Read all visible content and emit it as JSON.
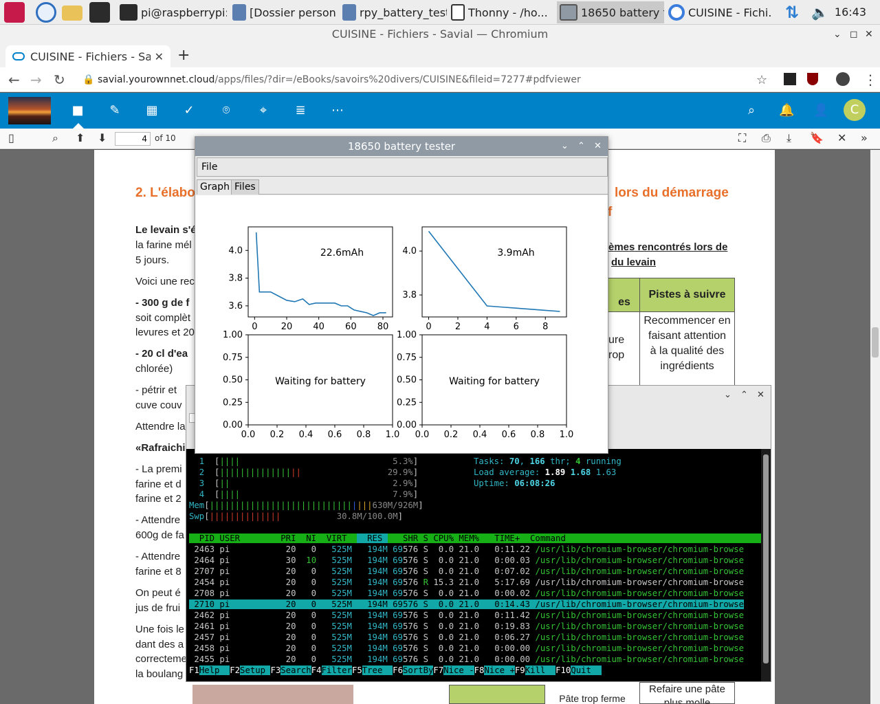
{
  "taskbar": {
    "buttons": [
      {
        "label": "pi@raspberrypi:..."
      },
      {
        "label": "[Dossier person..."
      },
      {
        "label": "rpy_battery_test..."
      },
      {
        "label": "Thonny  -  /ho..."
      },
      {
        "label": "18650 battery t..."
      },
      {
        "label": "CUISINE - Fichi..."
      }
    ],
    "clock": "16:43"
  },
  "browser": {
    "window_title": "CUISINE - Fichiers - Savial — Chromium",
    "tab_title": "CUISINE - Fichiers - Savia",
    "url_host": "savial.yourownnet.cloud",
    "url_path": "/apps/files/?dir=/eBooks/savoirs%20divers/CUISINE&fileid=7277#pdfviewer"
  },
  "nextcloud": {
    "avatar_letter": "C"
  },
  "pdfviewer": {
    "page_number": "4",
    "page_of": "of 10",
    "heading1": "2. L'élabo",
    "heading_right1": "lors du démarrage",
    "heading_right2": "f",
    "lines": [
      "Le levain s'é",
      "la farine mél",
      "5 jours.",
      "Voici une rec",
      "- 300 g de f",
      "soit complèt",
      "levures et 20",
      "- 20 cl d'ea",
      "chlorée)",
      "- pétrir et",
      "cuve couv",
      "Attendre la",
      "«Rafraichi",
      "- La premi",
      "farine et d",
      "farine et 2",
      "-  Attendre",
      "600g de fa",
      "- Attendre",
      "farine et 8",
      "On peut é",
      "jus de frui",
      "Une fois le",
      "dant des a",
      "correcteme",
      "la boulang"
    ],
    "side_head1": "èmes rencontrés lors de",
    "side_head2": "du levain",
    "table_header_left": "es",
    "table_header_right": "Pistes à suivre",
    "table_cell_left1": "ure",
    "table_cell_left2": "rop",
    "table_cell_right": [
      "Recommencer en",
      "faisant attention",
      "à la qualité des",
      "ingrédients"
    ],
    "bottom_cell_right": [
      "Refaire une pâte",
      "plus molle"
    ],
    "bottom_cell_mid": "Pâte trop ferme"
  },
  "battery_app": {
    "title": "18650 battery tester",
    "menu_file": "File",
    "tab_graph": "Graph",
    "tab_files": "Files"
  },
  "chart_data": [
    {
      "type": "line",
      "annotation": "22.6mAh",
      "x": [
        1,
        3,
        10,
        15,
        20,
        25,
        30,
        34,
        38,
        42,
        46,
        50,
        54,
        58,
        62,
        66,
        70,
        74,
        78,
        82
      ],
      "y": [
        4.13,
        3.7,
        3.7,
        3.67,
        3.64,
        3.63,
        3.65,
        3.61,
        3.62,
        3.62,
        3.62,
        3.62,
        3.6,
        3.6,
        3.57,
        3.56,
        3.55,
        3.53,
        3.55,
        3.55
      ],
      "xlim": [
        -4,
        86
      ],
      "ylim": [
        3.52,
        4.17
      ],
      "xticks": [
        "0",
        "20",
        "40",
        "60",
        "80"
      ],
      "yticks": [
        "4.0",
        "3.8",
        "3.6"
      ]
    },
    {
      "type": "line",
      "annotation": "3.9mAh",
      "x": [
        0,
        4,
        5,
        6,
        7,
        8,
        9
      ],
      "y": [
        4.09,
        3.75,
        3.745,
        3.74,
        3.735,
        3.73,
        3.725
      ],
      "xlim": [
        -0.45,
        9.45
      ],
      "ylim": [
        3.7,
        4.11
      ],
      "xticks": [
        "0",
        "2",
        "4",
        "6",
        "8"
      ],
      "yticks": [
        "4.0",
        "3.8"
      ]
    },
    {
      "type": "line",
      "annotation": "Waiting for battery",
      "x": [],
      "y": [],
      "xlim": [
        0,
        1
      ],
      "ylim": [
        0,
        1
      ],
      "xticks": [
        "0.0",
        "0.2",
        "0.4",
        "0.6",
        "0.8",
        "1.0"
      ],
      "yticks": [
        "1.00",
        "0.75",
        "0.50",
        "0.25",
        "0.00"
      ]
    },
    {
      "type": "line",
      "annotation": "Waiting for battery",
      "x": [],
      "y": [],
      "xlim": [
        0,
        1
      ],
      "ylim": [
        0,
        1
      ],
      "xticks": [
        "0.0",
        "0.2",
        "0.4",
        "0.6",
        "0.8",
        "1.0"
      ],
      "yticks": [
        "1.00",
        "0.75",
        "0.50",
        "0.25",
        "0.00"
      ]
    }
  ],
  "htop": {
    "cpus": [
      {
        "num": "1",
        "pct": "5.3%"
      },
      {
        "num": "2",
        "pct": "29.9%"
      },
      {
        "num": "3",
        "pct": "2.9%"
      },
      {
        "num": "4",
        "pct": "7.9%"
      }
    ],
    "mem": "630M/926M",
    "swp": "30.8M/100.0M",
    "tasks": "70",
    "threads": "166",
    "running": "4",
    "load1": "1.89",
    "load5": "1.68",
    "load15": "1.63",
    "uptime": "06:08:26",
    "columns": [
      "PID",
      "USER",
      "PRI",
      "NI",
      "VIRT",
      "RES",
      "SHR",
      "S",
      "CPU%",
      "MEM%",
      "TIME+",
      "Command"
    ],
    "rows": [
      {
        "pid": "2463",
        "user": "pi",
        "pri": "20",
        "ni": "0",
        "virt": "525M",
        "res": "194M",
        "shr": "69576",
        "s": "S",
        "cpu": "0.0",
        "mem": "21.0",
        "time": "0:11.22",
        "cmd": "/usr/lib/chromium-browser/chromium-browse"
      },
      {
        "pid": "2464",
        "user": "pi",
        "pri": "30",
        "ni": "10",
        "virt": "525M",
        "res": "194M",
        "shr": "69576",
        "s": "S",
        "cpu": "0.0",
        "mem": "21.0",
        "time": "0:00.03",
        "cmd": "/usr/lib/chromium-browser/chromium-browse"
      },
      {
        "pid": "2707",
        "user": "pi",
        "pri": "20",
        "ni": "0",
        "virt": "525M",
        "res": "194M",
        "shr": "69576",
        "s": "S",
        "cpu": "0.0",
        "mem": "21.0",
        "time": "0:07.02",
        "cmd": "/usr/lib/chromium-browser/chromium-browse"
      },
      {
        "pid": "2454",
        "user": "pi",
        "pri": "20",
        "ni": "0",
        "virt": "525M",
        "res": "194M",
        "shr": "69576",
        "s": "R",
        "cpu": "15.3",
        "mem": "21.0",
        "time": "5:17.69",
        "cmd": "/usr/lib/chromium-browser/chromium-browse"
      },
      {
        "pid": "2708",
        "user": "pi",
        "pri": "20",
        "ni": "0",
        "virt": "525M",
        "res": "194M",
        "shr": "69576",
        "s": "S",
        "cpu": "0.0",
        "mem": "21.0",
        "time": "0:00.02",
        "cmd": "/usr/lib/chromium-browser/chromium-browse"
      },
      {
        "pid": "2710",
        "user": "pi",
        "pri": "20",
        "ni": "0",
        "virt": "525M",
        "res": "194M",
        "shr": "69576",
        "s": "S",
        "cpu": "0.0",
        "mem": "21.0",
        "time": "0:14.43",
        "cmd": "/usr/lib/chromium-browser/chromium-browse"
      },
      {
        "pid": "2462",
        "user": "pi",
        "pri": "20",
        "ni": "0",
        "virt": "525M",
        "res": "194M",
        "shr": "69576",
        "s": "S",
        "cpu": "0.0",
        "mem": "21.0",
        "time": "0:11.42",
        "cmd": "/usr/lib/chromium-browser/chromium-browse"
      },
      {
        "pid": "2461",
        "user": "pi",
        "pri": "20",
        "ni": "0",
        "virt": "525M",
        "res": "194M",
        "shr": "69576",
        "s": "S",
        "cpu": "0.0",
        "mem": "21.0",
        "time": "0:19.83",
        "cmd": "/usr/lib/chromium-browser/chromium-browse"
      },
      {
        "pid": "2457",
        "user": "pi",
        "pri": "20",
        "ni": "0",
        "virt": "525M",
        "res": "194M",
        "shr": "69576",
        "s": "S",
        "cpu": "0.0",
        "mem": "21.0",
        "time": "0:06.27",
        "cmd": "/usr/lib/chromium-browser/chromium-browse"
      },
      {
        "pid": "2458",
        "user": "pi",
        "pri": "20",
        "ni": "0",
        "virt": "525M",
        "res": "194M",
        "shr": "69576",
        "s": "S",
        "cpu": "0.0",
        "mem": "21.0",
        "time": "0:00.00",
        "cmd": "/usr/lib/chromium-browser/chromium-browse"
      },
      {
        "pid": "2455",
        "user": "pi",
        "pri": "20",
        "ni": "0",
        "virt": "525M",
        "res": "194M",
        "shr": "69576",
        "s": "S",
        "cpu": "0.0",
        "mem": "21.0",
        "time": "0:00.00",
        "cmd": "/usr/lib/chromium-browser/chromium-browse"
      }
    ],
    "selected_pid": "2710",
    "fkeys": [
      {
        "key": "F1",
        "label": "Help"
      },
      {
        "key": "F2",
        "label": "Setup"
      },
      {
        "key": "F3",
        "label": "Search"
      },
      {
        "key": "F4",
        "label": "Filter"
      },
      {
        "key": "F5",
        "label": "Tree"
      },
      {
        "key": "F6",
        "label": "SortBy"
      },
      {
        "key": "F7",
        "label": "Nice -"
      },
      {
        "key": "F8",
        "label": "Nice +"
      },
      {
        "key": "F9",
        "label": "Kill"
      },
      {
        "key": "F10",
        "label": "Quit"
      }
    ]
  }
}
